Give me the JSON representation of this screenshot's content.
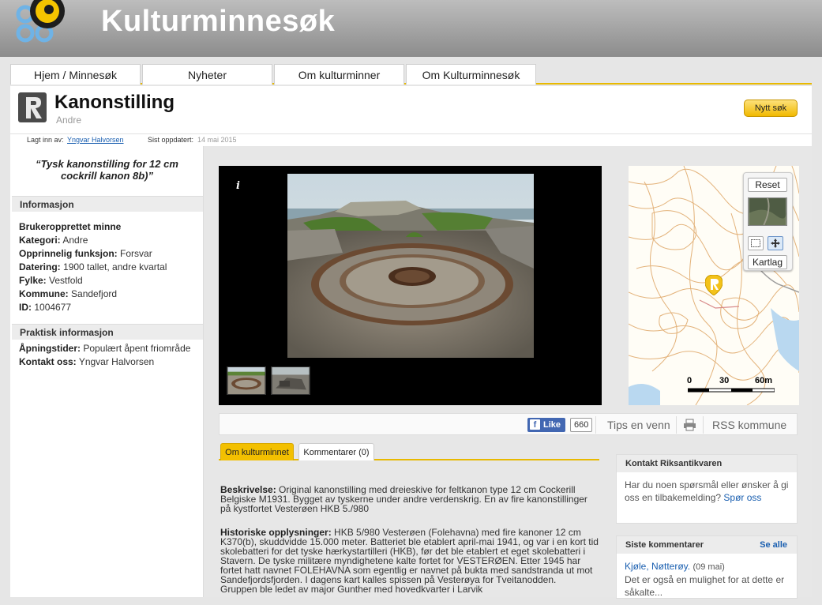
{
  "site": {
    "title": "Kulturminnesøk",
    "logo_icon": "kulturminnesok-logo-icon"
  },
  "nav": {
    "tabs": [
      {
        "label": "Hjem / Minnesøk"
      },
      {
        "label": "Nyheter"
      },
      {
        "label": "Om kulturminner"
      },
      {
        "label": "Om Kulturminnesøk"
      }
    ]
  },
  "record": {
    "title": "Kanonstilling",
    "category_sub": "Andre",
    "new_search_label": "Nytt søk",
    "badge_icon": "riksantikvaren-r-icon"
  },
  "meta": {
    "added_by_label": "Lagt inn av:",
    "added_by": "Yngvar Halvorsen",
    "updated_label": "Sist oppdatert:",
    "updated": "14 mai 2015"
  },
  "left": {
    "quote": "“Tysk kanonstilling for 12 cm cockrill kanon 8b)”",
    "info_heading": "Informasjon",
    "info_rows": [
      {
        "label": "Brukeropprettet minne",
        "value": ""
      },
      {
        "label": "Kategori:",
        "value": "Andre"
      },
      {
        "label": "Opprinnelig funksjon:",
        "value": "Forsvar"
      },
      {
        "label": "Datering:",
        "value": "1900 tallet, andre kvartal"
      },
      {
        "label": "Fylke:",
        "value": "Vestfold"
      },
      {
        "label": "Kommune:",
        "value": "Sandefjord"
      },
      {
        "label": "ID:",
        "value": "1004677"
      }
    ],
    "practical_heading": "Praktisk informasjon",
    "practical_rows": [
      {
        "label": "Åpningstider:",
        "value": "Populært åpent friområde"
      },
      {
        "label": "Kontakt oss:",
        "value": "Yngvar Halvorsen"
      }
    ]
  },
  "gallery": {
    "info_icon_text": "i",
    "thumb_count": 2
  },
  "map": {
    "reset_label": "Reset",
    "kartlag_label": "Kartlag",
    "scale_labels": [
      "0",
      "30",
      "60m"
    ],
    "marker_icon": "map-marker-r-icon"
  },
  "actions": {
    "like_label": "Like",
    "like_count": "660",
    "tips_label": "Tips en venn",
    "rss_label": "RSS kommune"
  },
  "tabs": {
    "about_label": "Om kulturminnet",
    "comments_label": "Kommentarer (0)"
  },
  "description": {
    "desc_label": "Beskrivelse:",
    "desc_lines": [
      " Original kanonstilling med dreieskive for feltkanon type 12 cm Cockerill",
      "Belgiske M1931. Bygget av tyskerne under andre verdenskrig. En av fire kanonstillinger",
      "på kystfortet Vesterøen HKB 5./980"
    ],
    "history_label": "Historiske opplysninger:",
    "history_lines": [
      " HKB 5/980 Vesterøen (Folehavna) med fire kanoner 12 cm",
      "K370(b), skuddvidde 15.000 meter. Batteriet ble etablert april-mai 1941, og var i en kort tid",
      "skolebatteri for det tyske hærkystartilleri (HKB), før det ble etablert et eget skolebatteri i",
      "Stavern. De tyske militære myndighetene kalte fortet for VESTERØEN. Etter 1945 har",
      "fortet hatt navnet FOLEHAVNA som egentlig er navnet på bukta med sandstranda ut mot",
      "Sandefjordsfjorden. I dagens kart kalles spissen på Vesterøya for Tveitanodden.",
      "Gruppen ble ledet av major Gunther med hovedkvarter i Larvik"
    ]
  },
  "contact": {
    "heading": "Kontakt Riksantikvaren",
    "text": "Har du noen spørsmål eller ønsker å gi oss en tilbakemelding?",
    "link": "Spør oss"
  },
  "comments": {
    "heading": "Siste kommentarer",
    "see_all": "Se alle",
    "items": [
      {
        "place": "Kjøle, Nøtterøy.",
        "date": "(09 mai)",
        "text": "Det er også en mulighet for at dette er såkalte..."
      }
    ]
  },
  "colors": {
    "accent": "#e8b900",
    "header_bg": "#9e9e9e",
    "link": "#1a5fb0",
    "facebook": "#4267b2"
  }
}
